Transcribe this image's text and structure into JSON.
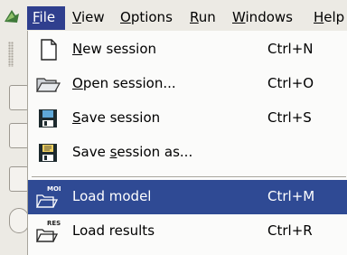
{
  "menubar": {
    "items": [
      {
        "mnemonic": "F",
        "rest": "ile"
      },
      {
        "mnemonic": "V",
        "rest": "iew"
      },
      {
        "mnemonic": "O",
        "rest": "ptions"
      },
      {
        "mnemonic": "R",
        "rest": "un"
      },
      {
        "mnemonic": "W",
        "rest": "indows"
      },
      {
        "mnemonic": "H",
        "rest": "elp"
      }
    ]
  },
  "file_menu": {
    "items": [
      {
        "pre": "",
        "mnemonic": "N",
        "rest": "ew session",
        "accel": "Ctrl+N",
        "icon": "new-document-icon"
      },
      {
        "pre": "",
        "mnemonic": "O",
        "rest": "pen session...",
        "accel": "Ctrl+O",
        "icon": "open-folder-icon"
      },
      {
        "pre": "",
        "mnemonic": "S",
        "rest": "ave session",
        "accel": "Ctrl+S",
        "icon": "save-disk-icon"
      },
      {
        "pre": "Save ",
        "mnemonic": "s",
        "rest": "ession as...",
        "accel": "",
        "icon": "save-as-icon"
      },
      {
        "pre": "Load model",
        "mnemonic": "",
        "rest": "",
        "accel": "Ctrl+M",
        "icon": "load-model-icon",
        "badge": "MOD"
      },
      {
        "pre": "Load results",
        "mnemonic": "",
        "rest": "",
        "accel": "Ctrl+R",
        "icon": "load-results-icon",
        "badge": "RES"
      }
    ]
  },
  "colors": {
    "menu_highlight": "#2f3f8e",
    "menu_background": "#fbfbfa",
    "bar_background": "#eceae4"
  }
}
